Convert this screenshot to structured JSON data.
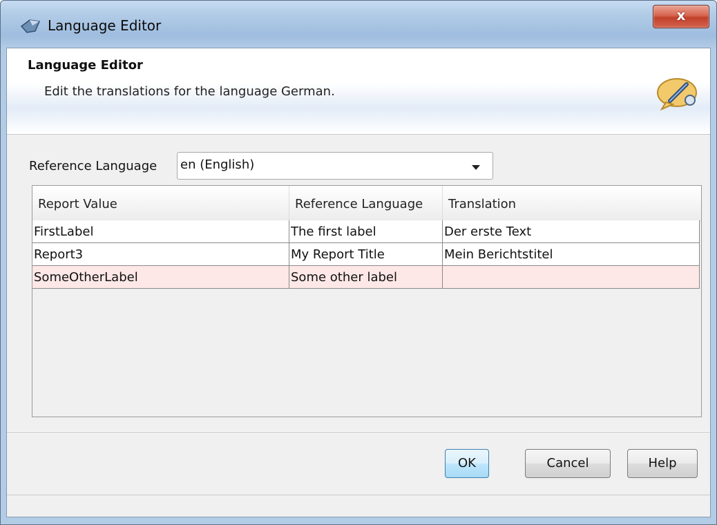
{
  "window": {
    "title": "Language Editor",
    "close_glyph": "x",
    "colors": {
      "accent": "#c2402a",
      "frame": "#9fbddf"
    }
  },
  "header": {
    "title": "Language Editor",
    "description": "Edit the translations for the language German.",
    "icon": "speech-bubble-edit-icon"
  },
  "reference_language": {
    "label": "Reference Language",
    "selected": "en (English)"
  },
  "table": {
    "columns": [
      "Report Value",
      "Reference Language",
      "Translation"
    ],
    "rows": [
      {
        "report_value": "FirstLabel",
        "reference": "The first label",
        "translation": "Der erste Text",
        "missing": false
      },
      {
        "report_value": "Report3",
        "reference": "My Report Title",
        "translation": "Mein Berichtstitel",
        "missing": false
      },
      {
        "report_value": "SomeOtherLabel",
        "reference": "Some other label",
        "translation": "",
        "missing": true
      }
    ],
    "colors": {
      "missing_row": "#fde7e7"
    }
  },
  "buttons": {
    "ok": "OK",
    "cancel": "Cancel",
    "help": "Help"
  }
}
